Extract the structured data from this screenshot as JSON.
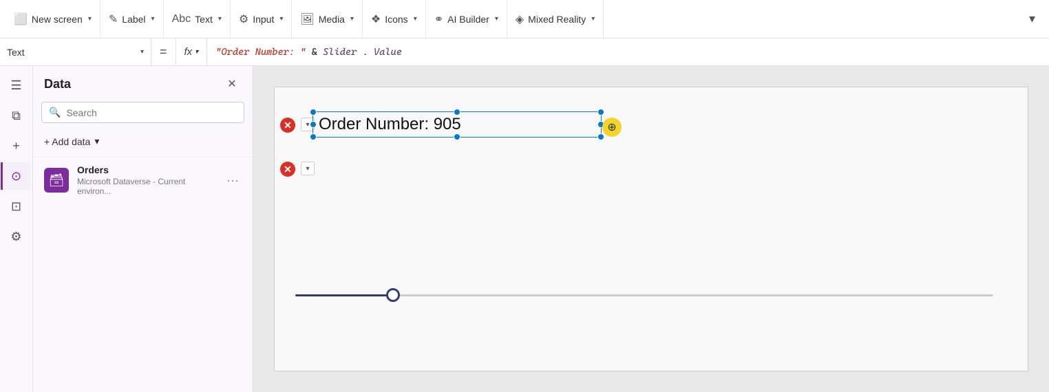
{
  "toolbar": {
    "new_screen_label": "New screen",
    "label_label": "Label",
    "text_label": "Text",
    "input_label": "Input",
    "media_label": "Media",
    "icons_label": "Icons",
    "ai_builder_label": "AI Builder",
    "mixed_reality_label": "Mixed Reality"
  },
  "formula_bar": {
    "property_label": "Text",
    "equals_symbol": "=",
    "fx_label": "fx",
    "formula_text": "\"Order Number: \" & Slider.Value"
  },
  "sidebar": {
    "tree_icon": "☰",
    "layers_icon": "⧉",
    "add_icon": "+",
    "data_icon": "⊙",
    "chart_icon": "⊡",
    "settings_icon": "⚙"
  },
  "data_panel": {
    "title": "Data",
    "close_icon": "✕",
    "search_placeholder": "Search",
    "add_data_label": "+ Add data",
    "items": [
      {
        "name": "Orders",
        "description": "Microsoft Dataverse - Current environ...",
        "icon": "🗃"
      }
    ]
  },
  "canvas": {
    "text_element": "Order Number: 905",
    "slider_value": 905
  }
}
